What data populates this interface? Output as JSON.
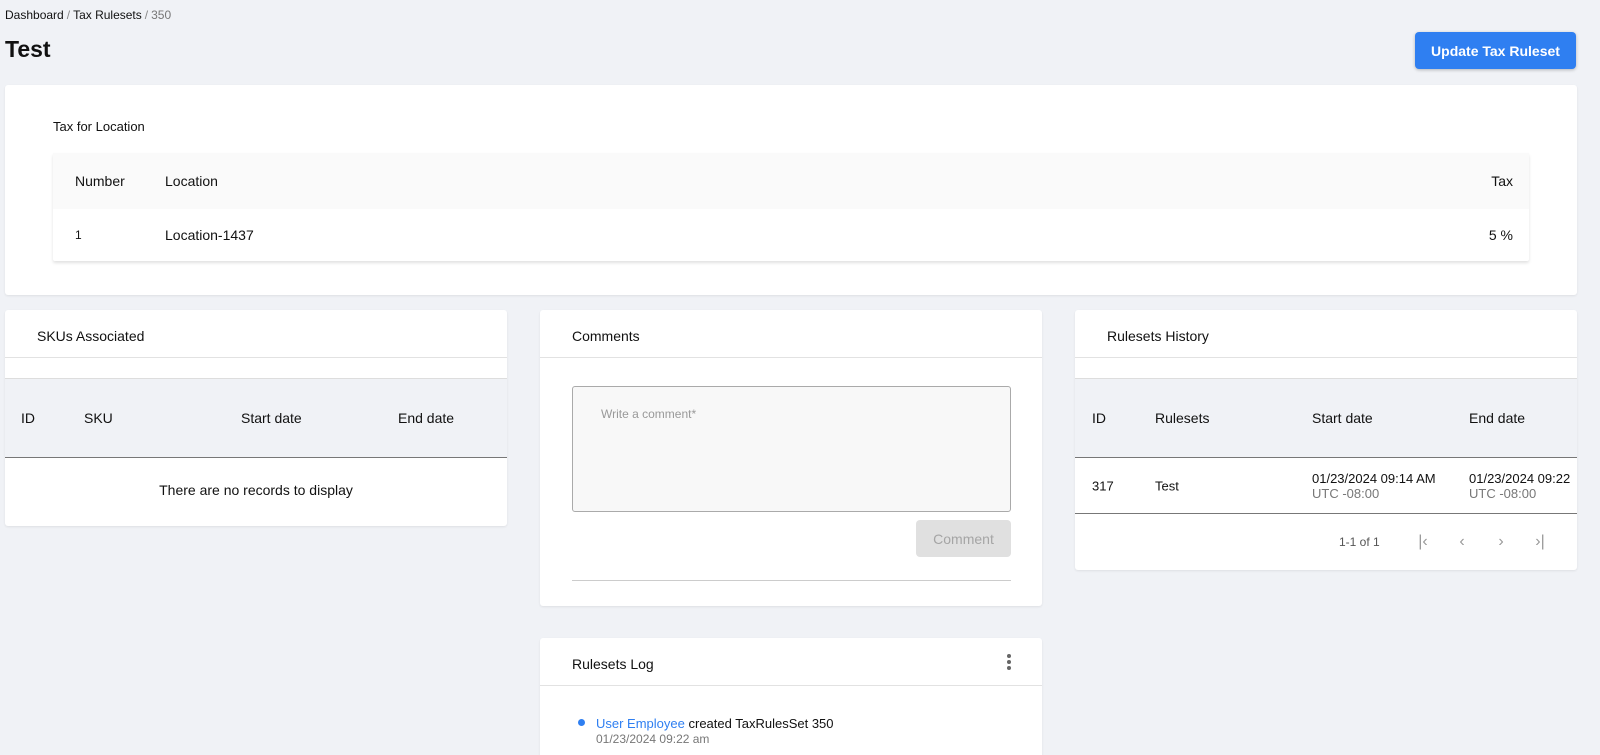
{
  "breadcrumb": {
    "items": [
      "Dashboard",
      "Tax Rulesets"
    ],
    "current": "350",
    "separator": "/"
  },
  "page": {
    "title": "Test",
    "update_button": "Update Tax Ruleset"
  },
  "tax_for_location": {
    "label": "Tax for Location",
    "columns": [
      "Number",
      "Location",
      "Tax"
    ],
    "rows": [
      {
        "number": "1",
        "location": "Location-1437",
        "tax": "5 %"
      }
    ]
  },
  "skus": {
    "title": "SKUs Associated",
    "columns": [
      "ID",
      "SKU",
      "Start date",
      "End date"
    ],
    "empty_text": "There are no records to display"
  },
  "comments": {
    "title": "Comments",
    "placeholder": "Write a comment*",
    "button": "Comment"
  },
  "log": {
    "title": "Rulesets Log",
    "entries": [
      {
        "user": "User Employee",
        "action": "created TaxRulesSet 350",
        "time": "01/23/2024 09:22 am"
      }
    ]
  },
  "history": {
    "title": "Rulesets History",
    "columns": [
      "ID",
      "Rulesets",
      "Start date",
      "End date"
    ],
    "rows": [
      {
        "id": "317",
        "ruleset": "Test",
        "start_date": "01/23/2024 09:14 AM",
        "start_tz": "UTC -08:00",
        "end_date": "01/23/2024 09:22",
        "end_tz": "UTC -08:00"
      }
    ],
    "pagination": "1-1 of 1"
  },
  "colors": {
    "accent": "#2f7ff1",
    "background": "#f0f2f6"
  }
}
